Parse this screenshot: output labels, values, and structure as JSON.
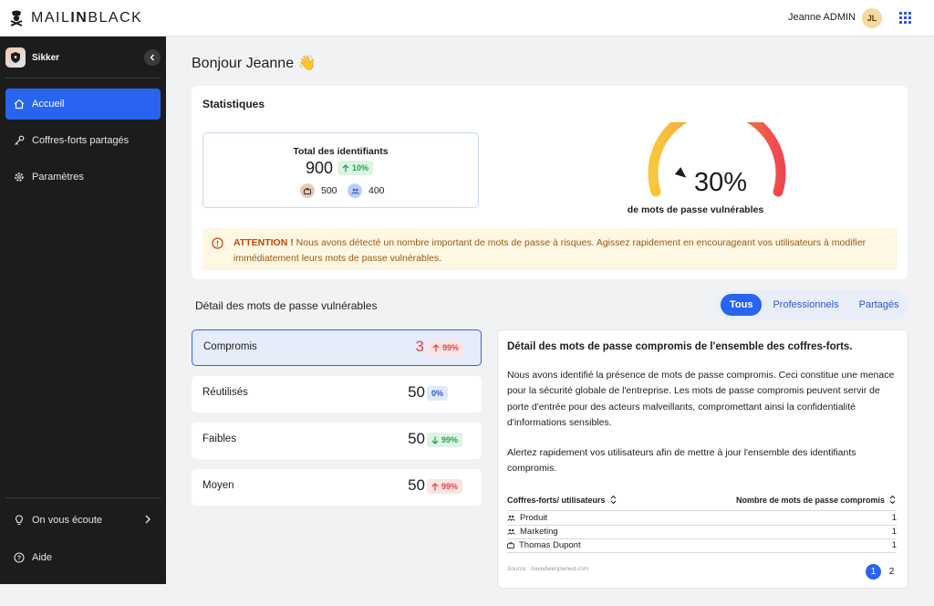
{
  "app": {
    "brand_light": "MAIL",
    "brand_bold": "IN",
    "brand_end": "BLACK"
  },
  "user": {
    "name": "Jeanne ADMIN",
    "initials": "JL"
  },
  "sidebar": {
    "workspace": "Sikker",
    "items": [
      {
        "label": "Accueil",
        "icon": "home-icon",
        "active": true
      },
      {
        "label": "Coffres-forts partagés",
        "icon": "key-icon",
        "active": false
      },
      {
        "label": "Paramètres",
        "icon": "gear-icon",
        "active": false
      }
    ],
    "bottom": [
      {
        "label": "On vous écoute",
        "icon": "lightbulb-icon"
      },
      {
        "label": "Aide",
        "icon": "help-icon"
      }
    ]
  },
  "greeting": "Bonjour Jeanne 👋",
  "stats": {
    "title": "Statistiques",
    "total_title": "Total des identifiants",
    "total_value": "900",
    "total_badge": "10%",
    "pro_count": "500",
    "shared_count": "400",
    "gauge_value": "30%",
    "gauge_fraction": 0.3,
    "gauge_label": "de mots de passe vulnérables",
    "alert_strong": "ATTENTION !",
    "alert_text": "Nous avons détecté un nombre important de mots de passe à risques. Agissez rapidement en encourageant vos utilisateurs à modifier immédiatement leurs mots de passe vulnérables."
  },
  "vuln": {
    "title": "Détail des mots de passe vulnérables",
    "tabs": [
      "Tous",
      "Professionnels",
      "Partagés"
    ],
    "rows": [
      {
        "label": "Compromis",
        "value": "3",
        "badge": "99%",
        "trend": "up"
      },
      {
        "label": "Réutilisés",
        "value": "50",
        "badge": "0%",
        "trend": "none"
      },
      {
        "label": "Faibles",
        "value": "50",
        "badge": "99%",
        "trend": "down"
      },
      {
        "label": "Moyen",
        "value": "50",
        "badge": "99%",
        "trend": "up"
      }
    ]
  },
  "detail": {
    "title": "Détail des mots de passe compromis de l'ensemble des coffres-forts.",
    "p1": "Nous avons identifié la présence de mots de passe compromis. Ceci constitue une menace pour la sécurité globale de l'entreprise. Les mots de passe compromis peuvent servir de porte d'entrée pour des acteurs malveillants, compromettant ainsi la confidentialité d'informations sensibles.",
    "p2": "Alertez rapidement vos utilisateurs afin de mettre à jour l'ensemble des identifiants compromis.",
    "col1": "Coffres-forts/ utilisateurs",
    "col2": "Nombre de mots de passe compromis",
    "rows": [
      {
        "name": "Produit",
        "count": "1",
        "icon": "group-icon"
      },
      {
        "name": "Marketing",
        "count": "1",
        "icon": "group-icon"
      },
      {
        "name": "Thomas Dupont",
        "count": "1",
        "icon": "briefcase-icon"
      }
    ],
    "source": "Source : haveibeenpwned.com",
    "pages": [
      "1",
      "2"
    ]
  }
}
